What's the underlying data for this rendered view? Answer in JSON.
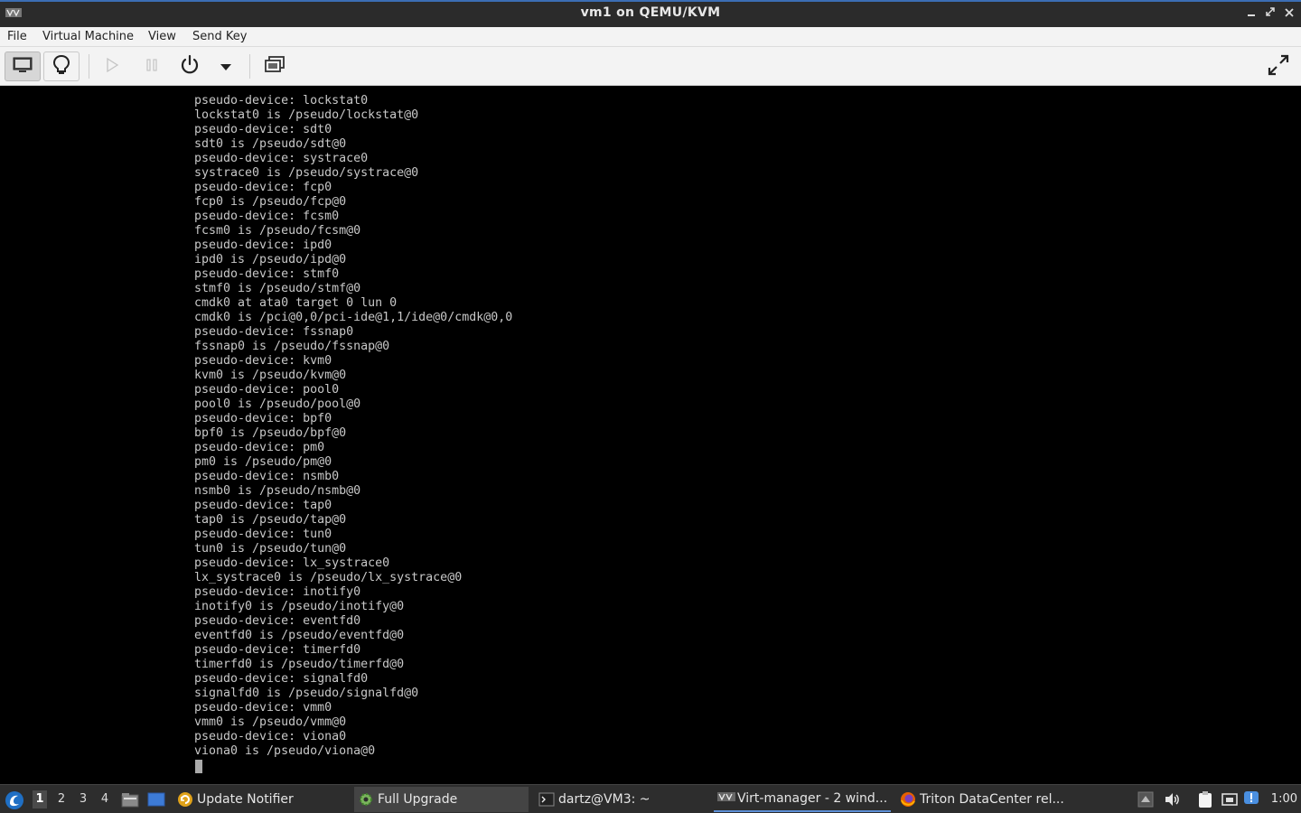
{
  "window": {
    "title": "vm1 on QEMU/KVM",
    "app_icon": "virt-manager-icon",
    "controls": [
      "minimize-icon",
      "maximize-icon",
      "close-icon"
    ]
  },
  "menubar": {
    "items": [
      "File",
      "Virtual Machine",
      "View",
      "Send Key"
    ]
  },
  "toolbar": {
    "buttons": [
      {
        "icon": "monitor-icon",
        "state": "active"
      },
      {
        "icon": "lightbulb-icon",
        "state": "normal"
      },
      {
        "icon": "play-icon",
        "state": "disabled"
      },
      {
        "icon": "pause-icon",
        "state": "disabled"
      },
      {
        "icon": "power-icon",
        "state": "normal"
      },
      {
        "icon": "chevron-down-icon",
        "state": "normal"
      },
      {
        "icon": "screenshot-icon",
        "state": "normal"
      },
      {
        "icon": "fullscreen-icon",
        "state": "normal"
      }
    ]
  },
  "console": {
    "lines": [
      "pseudo-device: lockstat0",
      "lockstat0 is /pseudo/lockstat@0",
      "pseudo-device: sdt0",
      "sdt0 is /pseudo/sdt@0",
      "pseudo-device: systrace0",
      "systrace0 is /pseudo/systrace@0",
      "pseudo-device: fcp0",
      "fcp0 is /pseudo/fcp@0",
      "pseudo-device: fcsm0",
      "fcsm0 is /pseudo/fcsm@0",
      "pseudo-device: ipd0",
      "ipd0 is /pseudo/ipd@0",
      "pseudo-device: stmf0",
      "stmf0 is /pseudo/stmf@0",
      "cmdk0 at ata0 target 0 lun 0",
      "cmdk0 is /pci@0,0/pci-ide@1,1/ide@0/cmdk@0,0",
      "pseudo-device: fssnap0",
      "fssnap0 is /pseudo/fssnap@0",
      "pseudo-device: kvm0",
      "kvm0 is /pseudo/kvm@0",
      "pseudo-device: pool0",
      "pool0 is /pseudo/pool@0",
      "pseudo-device: bpf0",
      "bpf0 is /pseudo/bpf@0",
      "pseudo-device: pm0",
      "pm0 is /pseudo/pm@0",
      "pseudo-device: nsmb0",
      "nsmb0 is /pseudo/nsmb@0",
      "pseudo-device: tap0",
      "tap0 is /pseudo/tap@0",
      "pseudo-device: tun0",
      "tun0 is /pseudo/tun@0",
      "pseudo-device: lx_systrace0",
      "lx_systrace0 is /pseudo/lx_systrace@0",
      "pseudo-device: inotify0",
      "inotify0 is /pseudo/inotify@0",
      "pseudo-device: eventfd0",
      "eventfd0 is /pseudo/eventfd@0",
      "pseudo-device: timerfd0",
      "timerfd0 is /pseudo/timerfd@0",
      "pseudo-device: signalfd0",
      "signalfd0 is /pseudo/signalfd@0",
      "pseudo-device: vmm0",
      "vmm0 is /pseudo/vmm@0",
      "pseudo-device: viona0",
      "viona0 is /pseudo/viona@0"
    ]
  },
  "taskbar": {
    "start_icon": "distro-logo-icon",
    "workspaces": [
      "1",
      "2",
      "3",
      "4"
    ],
    "current_workspace": "1",
    "launchers": [
      "file-manager-icon",
      "show-desktop-icon"
    ],
    "tasks": [
      {
        "label": "Update Notifier",
        "icon": "update-notifier-icon"
      },
      {
        "label": "Full Upgrade",
        "icon": "gear-icon"
      },
      {
        "label": "dartz@VM3: ~",
        "icon": "terminal-icon"
      },
      {
        "label": "Virt-manager - 2 wind...",
        "icon": "virt-manager-icon"
      },
      {
        "label": "Triton DataCenter rel...",
        "icon": "firefox-icon"
      }
    ],
    "tray_icons": [
      "tray-up-arrow-icon",
      "volume-icon",
      "clipboard-icon",
      "network-icon",
      "notification-icon"
    ],
    "clock": "1:00"
  }
}
